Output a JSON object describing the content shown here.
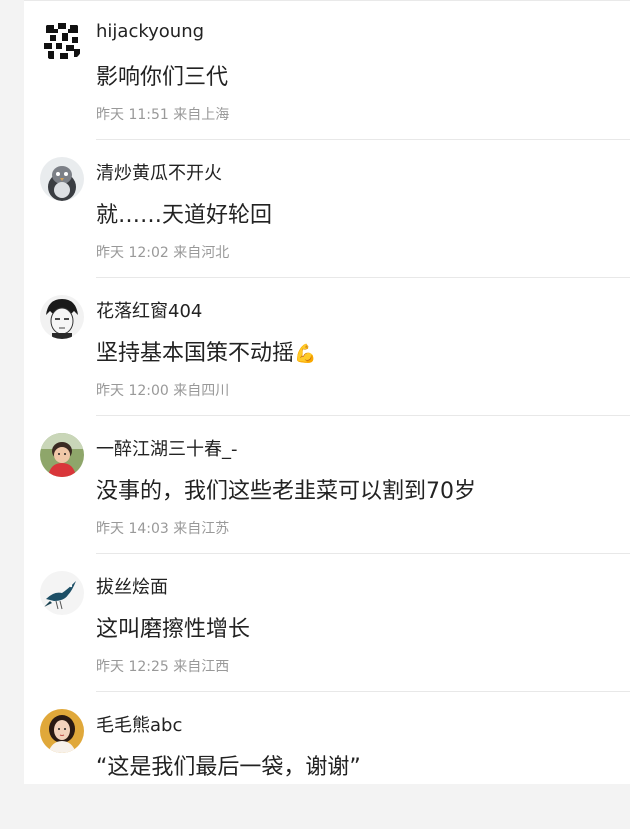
{
  "comments": [
    {
      "username": "hijackyoung",
      "text": "影响你们三代",
      "time": "昨天 11:51",
      "location": "来自上海",
      "avatar_icon": "pixel-pattern-avatar"
    },
    {
      "username": "清炒黄瓜不开火",
      "text": "就……天道好轮回",
      "time": "昨天 12:02",
      "location": "来自河北",
      "avatar_icon": "penguin-avatar"
    },
    {
      "username": "花落红窗404",
      "text": "坚持基本国策不动摇",
      "emoji": "💪",
      "time": "昨天 12:00",
      "location": "来自四川",
      "avatar_icon": "anime-face-avatar"
    },
    {
      "username": "一醉江湖三十春_-",
      "text": "没事的，我们这些老韭菜可以割到70岁",
      "time": "昨天 14:03",
      "location": "来自江苏",
      "avatar_icon": "child-photo-avatar"
    },
    {
      "username": "拔丝烩面",
      "text": "这叫磨擦性增长",
      "time": "昨天 12:25",
      "location": "来自江西",
      "avatar_icon": "bird-avatar"
    },
    {
      "username": "毛毛熊abc",
      "text": "“这是我们最后一袋，谢谢”",
      "time": "",
      "location": "",
      "avatar_icon": "girl-photo-avatar"
    }
  ]
}
